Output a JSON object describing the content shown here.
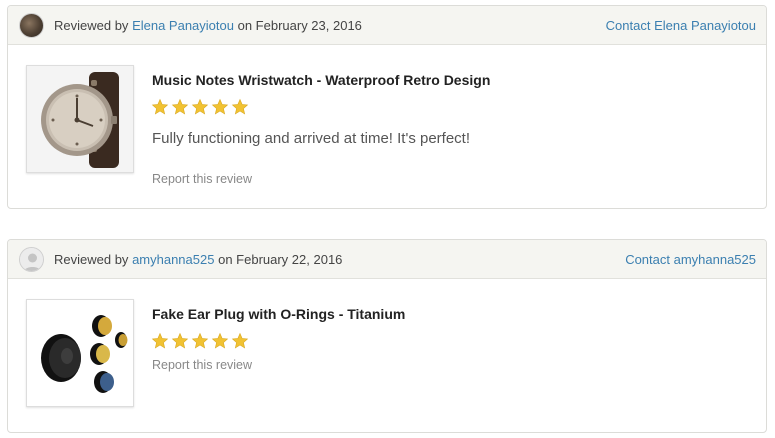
{
  "reviews": [
    {
      "reviewed_prefix": "Reviewed by",
      "reviewer": "Elena Panayiotou",
      "date_text": "on February 23, 2016",
      "contact": "Contact Elena Panayiotou",
      "avatar": "user-photo-icon",
      "product_title": "Music Notes Wristwatch - Waterproof Retro Design",
      "product_image": "wristwatch-image",
      "rating": 5,
      "rating_max": 5,
      "text": "Fully functioning and arrived at time! It's perfect!",
      "report": "Report this review"
    },
    {
      "reviewed_prefix": "Reviewed by",
      "reviewer": "amyhanna525",
      "date_text": "on February 22, 2016",
      "contact": "Contact amyhanna525",
      "avatar": "default-user-icon",
      "product_title": "Fake Ear Plug with O-Rings - Titanium",
      "product_image": "ear-plug-image",
      "rating": 5,
      "rating_max": 5,
      "text": "",
      "report": "Report this review"
    }
  ],
  "colors": {
    "link": "#3b7fb0",
    "star": "#f1c232",
    "header_bg": "#f5f5f1"
  }
}
